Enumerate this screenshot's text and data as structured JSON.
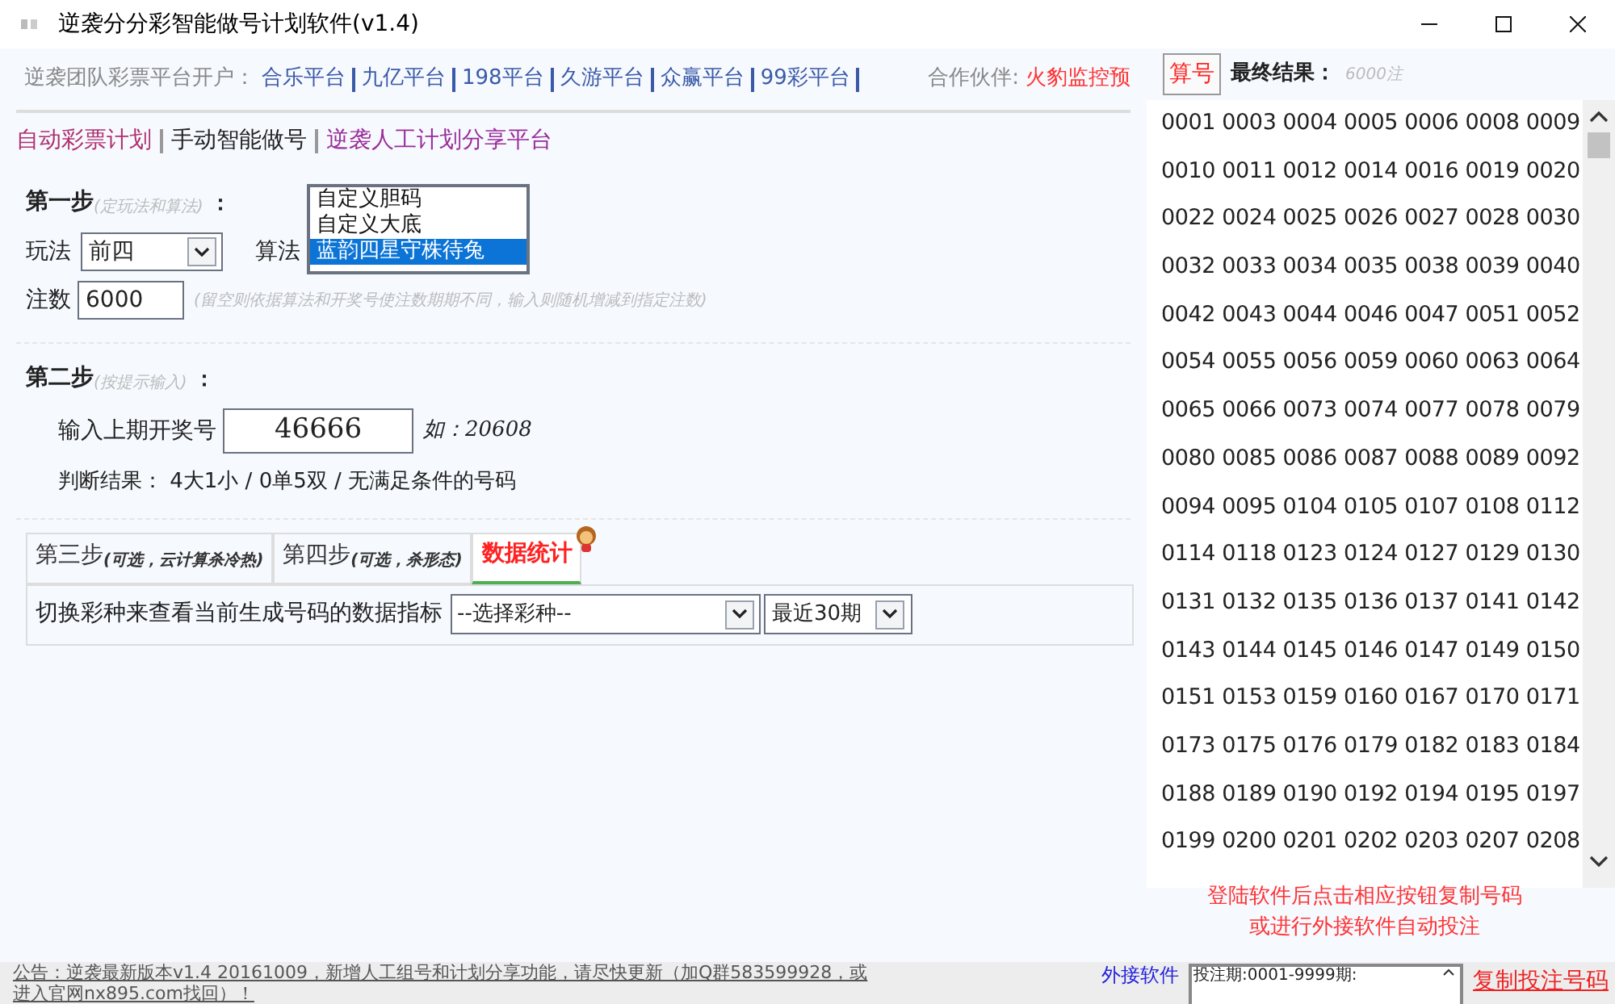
{
  "window": {
    "title": "逆袭分分彩智能做号计划软件(v1.4)"
  },
  "header": {
    "label": "逆袭团队彩票平台开户：",
    "links": [
      "合乐平台",
      "九亿平台",
      "198平台",
      "久游平台",
      "众赢平台",
      "99彩平台"
    ],
    "partner_label": "合作伙伴:",
    "partner": "火豹监控预"
  },
  "nav": [
    {
      "label": "自动彩票计划",
      "selected": false
    },
    {
      "label": "手动智能做号",
      "selected": true
    },
    {
      "label": "逆袭人工计划分享平台",
      "selected": false
    }
  ],
  "step1": {
    "title": "第一步",
    "hint": "(定玩法和算法)",
    "colon": "：",
    "play_label": "玩法",
    "play_value": "前四",
    "algo_label": "算法",
    "algo_options": [
      {
        "label": "自定义胆码",
        "selected": false
      },
      {
        "label": "自定义大底",
        "selected": false
      },
      {
        "label": "蓝韵四星守株待兔",
        "selected": true
      }
    ],
    "count_label": "注数",
    "count_value": "6000",
    "count_hint": "(留空则依据算法和开奖号使注数期期不同，输入则随机增减到指定注数)"
  },
  "step2": {
    "title": "第二步",
    "hint": "(按提示输入)",
    "colon": "：",
    "input_label": "输入上期开奖号",
    "input_value": "46666",
    "example": "如：20608",
    "result": "判断结果： 4大1小 / 0单5双 / 无满足条件的号码"
  },
  "tabs": [
    {
      "title": "第三步",
      "hint": "(可选，云计算杀冷热)",
      "selected": false
    },
    {
      "title": "第四步",
      "hint": "(可选，杀形态)",
      "selected": false
    },
    {
      "title": "数据统计",
      "selected": true
    }
  ],
  "stats": {
    "label": "切换彩种来查看当前生成号码的数据指标",
    "lottery": "--选择彩种--",
    "period": "最近30期"
  },
  "results": {
    "button": "算号",
    "title": "最终结果：",
    "count": "6000注",
    "rows": [
      "0001 0003 0004 0005 0006 0008 0009",
      "0010 0011 0012 0014 0016 0019 0020",
      "0022 0024 0025 0026 0027 0028 0030",
      "0032 0033 0034 0035 0038 0039 0040",
      "0042 0043 0044 0046 0047 0051 0052",
      "0054 0055 0056 0059 0060 0063 0064",
      "0065 0066 0073 0074 0077 0078 0079",
      "0080 0085 0086 0087 0088 0089 0092",
      "0094 0095 0104 0105 0107 0108 0112",
      "0114 0118 0123 0124 0127 0129 0130",
      "0131 0132 0135 0136 0137 0141 0142",
      "0143 0144 0145 0146 0147 0149 0150",
      "0151 0153 0159 0160 0167 0170 0171",
      "0173 0175 0176 0179 0182 0183 0184",
      "0188 0189 0190 0192 0194 0195 0197",
      "0199 0200 0201 0202 0203 0207 0208"
    ],
    "notice": [
      "登陆软件后点击相应按钮复制号码",
      "或进行外接软件自动投注"
    ]
  },
  "footer": {
    "announcement": "公告：逆袭最新版本v1.4 20161009，新增人工组号和计划分享功能，请尽快更新（加Q群583599928，或进入官网nx895.com找回）！",
    "external": [
      "外接软件"
    ],
    "bet_lines": [
      "投注期:0001-9999期:"
    ],
    "links": [
      "复制投注号码"
    ]
  }
}
